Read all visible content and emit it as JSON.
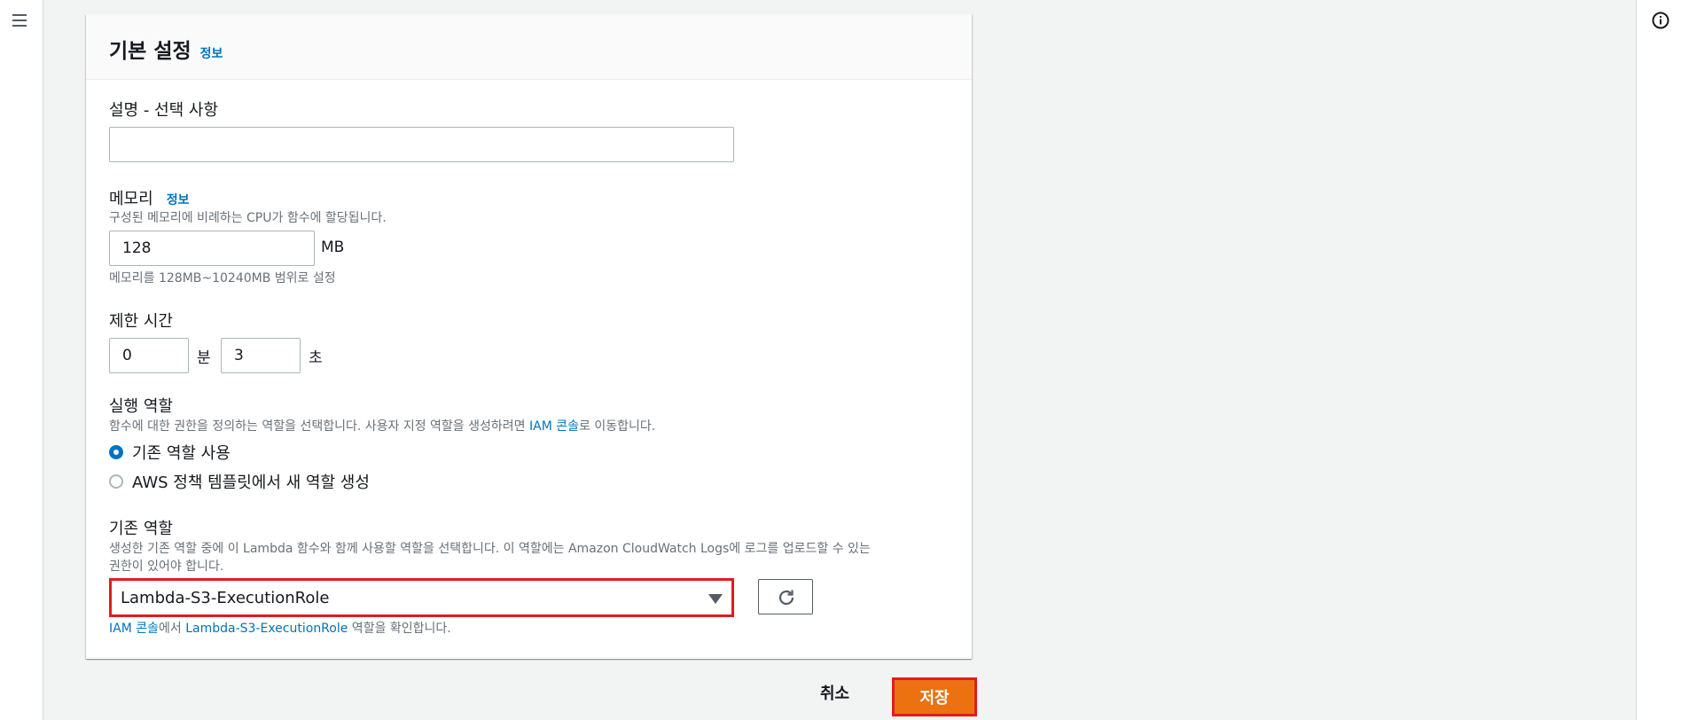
{
  "panel": {
    "title": "기본 설정",
    "title_info": "정보"
  },
  "description": {
    "label": "설명",
    "label_sep": " - ",
    "optional": "선택 사항",
    "value": ""
  },
  "memory": {
    "label": "메모리",
    "info": "정보",
    "desc": "구성된 메모리에 비례하는 CPU가 함수에 할당됩니다.",
    "value": "128",
    "unit": "MB",
    "constraint": "메모리를 128MB~10240MB 범위로 설정"
  },
  "timeout": {
    "label": "제한 시간",
    "minutes_value": "0",
    "minutes_unit": "분",
    "seconds_value": "3",
    "seconds_unit": "초"
  },
  "execution_role": {
    "label": "실행 역할",
    "desc_prefix": "함수에 대한 권한을 정의하는 역할을 선택합니다. 사용자 지정 역할을 생성하려면 ",
    "desc_link": "IAM 콘솔",
    "desc_suffix": "로 이동합니다.",
    "options": [
      {
        "label": "기존 역할 사용",
        "checked": true
      },
      {
        "label": "AWS 정책 템플릿에서 새 역할 생성",
        "checked": false
      }
    ]
  },
  "existing_role": {
    "label": "기존 역할",
    "desc_line1": "생성한 기존 역할 중에 이 Lambda 함수와 함께 사용할 역할을 선택합니다. 이 역할에는 Amazon CloudWatch Logs에 로그를 업로드할 수 있는",
    "desc_line2": "권한이 있어야 합니다.",
    "selected": "Lambda-S3-ExecutionRole",
    "hint_link1": "IAM 콘솔",
    "hint_mid": "에서 ",
    "hint_link2": "Lambda-S3-ExecutionRole",
    "hint_suffix": " 역할을 확인합니다."
  },
  "actions": {
    "cancel": "취소",
    "save": "저장"
  },
  "colors": {
    "accent": "#0073bb",
    "primary_button": "#ec7211",
    "highlight_border": "#e11b22"
  }
}
